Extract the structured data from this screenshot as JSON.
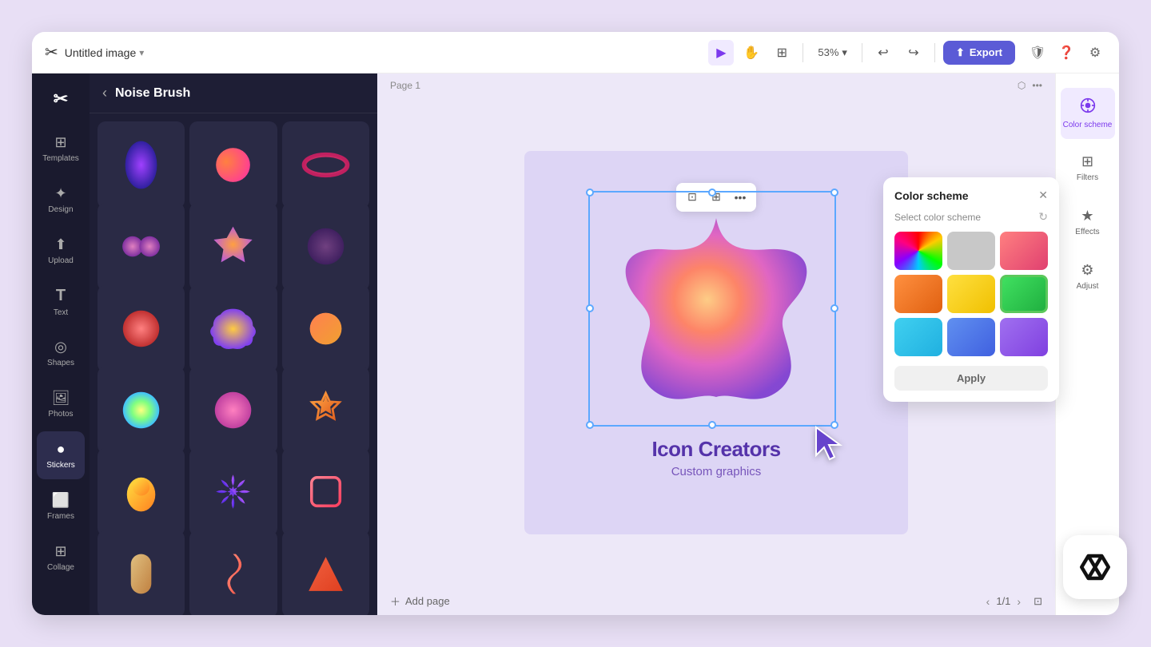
{
  "app": {
    "title": "Untitled image",
    "zoom": "53%",
    "page_label": "Page 1",
    "page_count": "1/1"
  },
  "topbar": {
    "file_name": "Untitled image",
    "zoom": "53%",
    "export_label": "Export",
    "undo_label": "Undo",
    "redo_label": "Redo"
  },
  "sidebar": {
    "items": [
      {
        "id": "templates",
        "label": "Templates",
        "icon": "⊞"
      },
      {
        "id": "design",
        "label": "Design",
        "icon": "✦"
      },
      {
        "id": "upload",
        "label": "Upload",
        "icon": "⬆"
      },
      {
        "id": "text",
        "label": "Text",
        "icon": "T"
      },
      {
        "id": "shapes",
        "label": "Shapes",
        "icon": "◎"
      },
      {
        "id": "photos",
        "label": "Photos",
        "icon": "⊡"
      },
      {
        "id": "stickers",
        "label": "Stickers",
        "icon": "●"
      },
      {
        "id": "frames",
        "label": "Frames",
        "icon": "⊡"
      },
      {
        "id": "collage",
        "label": "Collage",
        "icon": "⊞"
      }
    ]
  },
  "sticker_panel": {
    "title": "Noise Brush",
    "back_label": "Back"
  },
  "canvas": {
    "title_text": "Icon Creators",
    "subtitle_text": "Custom graphics",
    "page_label": "Page 1",
    "add_page_label": "Add page",
    "page_nav": "1/1"
  },
  "color_scheme": {
    "title": "Color scheme",
    "subtitle": "Select color scheme",
    "apply_label": "Apply",
    "swatches": [
      {
        "id": "rainbow",
        "type": "gradient"
      },
      {
        "id": "gray",
        "color": "#d0d0d0"
      },
      {
        "id": "pink",
        "color": "#f06090"
      },
      {
        "id": "orange",
        "color": "#f07020"
      },
      {
        "id": "yellow",
        "color": "#f0c020"
      },
      {
        "id": "green",
        "color": "#20d060"
      },
      {
        "id": "cyan",
        "color": "#20c8e0"
      },
      {
        "id": "blue",
        "color": "#5080f0"
      },
      {
        "id": "purple",
        "color": "#9060f0"
      }
    ]
  },
  "right_panel": {
    "items": [
      {
        "id": "color-scheme",
        "label": "Color scheme",
        "icon": "⬡"
      },
      {
        "id": "filters",
        "label": "Filters",
        "icon": "⊞"
      },
      {
        "id": "effects",
        "label": "Effects",
        "icon": "★"
      },
      {
        "id": "adjust",
        "label": "Adjust",
        "icon": "⚙"
      }
    ]
  },
  "float_toolbar": {
    "crop_label": "Crop",
    "duplicate_label": "Duplicate",
    "more_label": "More"
  }
}
